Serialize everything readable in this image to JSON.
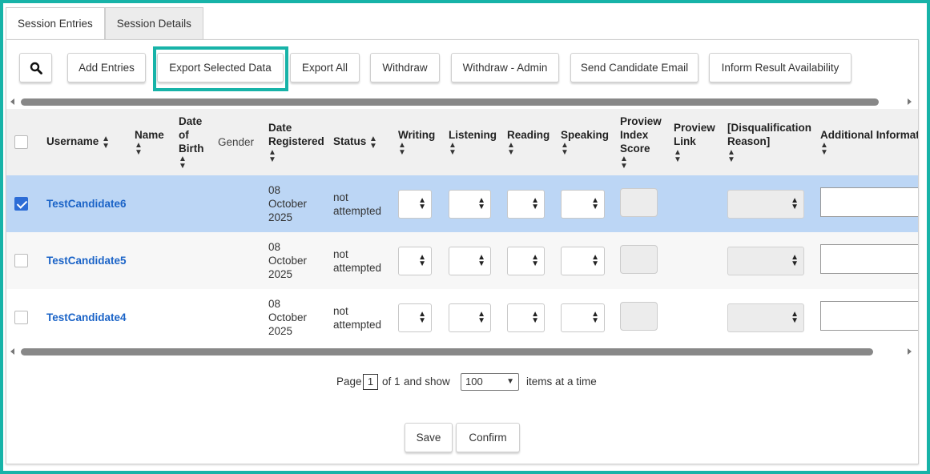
{
  "tabs": [
    "Session Entries",
    "Session Details"
  ],
  "toolbar": {
    "search_icon": "magnifier-icon",
    "buttons": [
      "Add Entries",
      "Export Selected Data",
      "Export All",
      "Withdraw",
      "Withdraw - Admin",
      "Send Candidate Email",
      "Inform Result Availability"
    ]
  },
  "colors": {
    "accent": "#17b3a8",
    "link": "#1a63c7",
    "selected_row": "#bcd6f5",
    "checkbox": "#2c6cd6"
  },
  "table": {
    "headers": {
      "username": "Username",
      "name": "Name",
      "dob": "Date of Birth",
      "gender": "Gender",
      "date_registered": "Date Registered",
      "status": "Status",
      "writing": "Writing",
      "listening": "Listening",
      "reading": "Reading",
      "speaking": "Speaking",
      "proview_score": "Proview Index Score",
      "proview_link": "Proview Link",
      "disq_reason": "[Disqualification Reason]",
      "additional": "Additional Informati"
    },
    "rows": [
      {
        "username": "TestCandidate6",
        "date_registered": "08 October 2025",
        "status": "not attempted",
        "checked": true
      },
      {
        "username": "TestCandidate5",
        "date_registered": "08 October 2025",
        "status": "not attempted",
        "checked": false
      },
      {
        "username": "TestCandidate4",
        "date_registered": "08 October 2025",
        "status": "not attempted",
        "checked": false
      }
    ]
  },
  "pager": {
    "page_label": "Page",
    "page": "1",
    "of_label": "of 1",
    "and_show": "and show",
    "per_page": "100",
    "suffix": "items at a time"
  },
  "footer": {
    "save": "Save",
    "confirm": "Confirm"
  }
}
